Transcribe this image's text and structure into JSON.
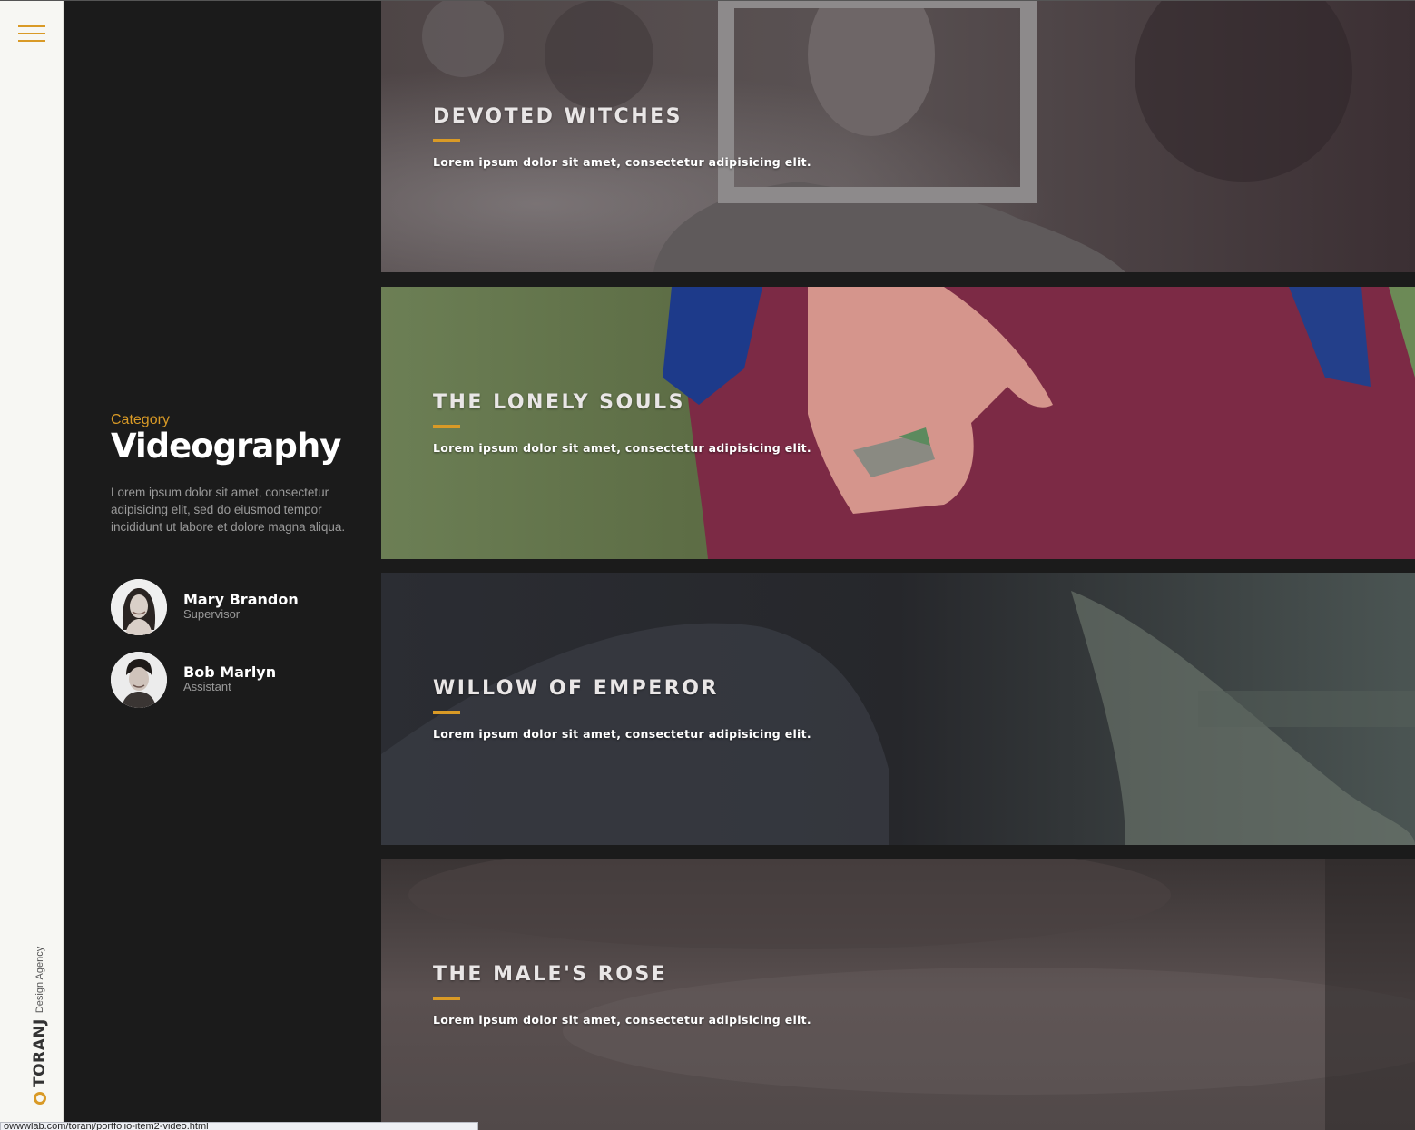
{
  "sidebar": {
    "brand_name": "TORANJ",
    "brand_tagline": "Design Agency",
    "accent_color": "#d99a26"
  },
  "category": {
    "label": "Category",
    "title": "Videography",
    "description": "Lorem ipsum dolor sit amet, consectetur adipisicing elit, sed do eiusmod tempor incididunt ut labore et dolore magna aliqua."
  },
  "team": [
    {
      "name": "Mary Brandon",
      "role": "Supervisor"
    },
    {
      "name": "Bob Marlyn",
      "role": "Assistant"
    }
  ],
  "portfolio": [
    {
      "title": "DEVOTED WITCHES",
      "description": "Lorem ipsum dolor sit amet, consectetur adipisicing elit."
    },
    {
      "title": "THE LONELY SOULS",
      "description": "Lorem ipsum dolor sit amet, consectetur adipisicing elit."
    },
    {
      "title": "WILLOW OF EMPEROR",
      "description": "Lorem ipsum dolor sit amet, consectetur adipisicing elit."
    },
    {
      "title": "THE MALE'S ROSE",
      "description": "Lorem ipsum dolor sit amet, consectetur adipisicing elit."
    }
  ],
  "status_bar": {
    "url": "owwwlab.com/toranj/portfolio-item2-video.html"
  }
}
